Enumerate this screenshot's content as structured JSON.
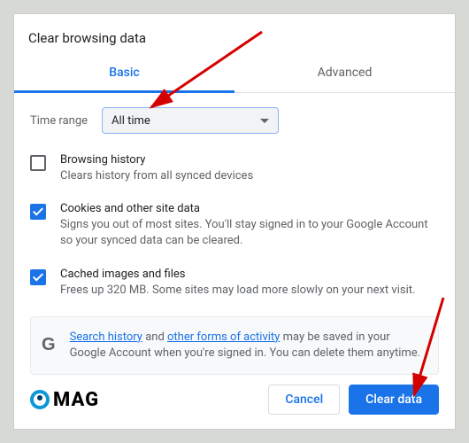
{
  "title": "Clear browsing data",
  "tabs": {
    "basic": "Basic",
    "advanced": "Advanced"
  },
  "timerange": {
    "label": "Time range",
    "value": "All time"
  },
  "options": [
    {
      "checked": false,
      "title": "Browsing history",
      "sub": "Clears history from all synced devices"
    },
    {
      "checked": true,
      "title": "Cookies and other site data",
      "sub": "Signs you out of most sites. You'll stay signed in to your Google Account so your synced data can be cleared."
    },
    {
      "checked": true,
      "title": "Cached images and files",
      "sub": "Frees up 320 MB. Some sites may load more slowly on your next visit."
    }
  ],
  "info": {
    "link1": "Search history",
    "mid": " and ",
    "link2": "other forms of activity",
    "rest": " may be saved in your Google Account when you're signed in. You can delete them anytime."
  },
  "logo": "MAG",
  "buttons": {
    "cancel": "Cancel",
    "clear": "Clear data"
  }
}
